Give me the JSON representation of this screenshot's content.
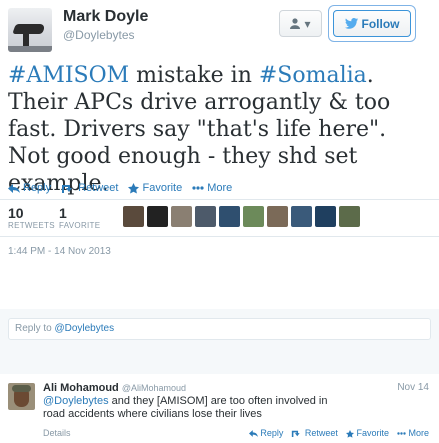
{
  "author": {
    "name": "Mark Doyle",
    "handle": "@Doylebytes"
  },
  "header": {
    "user_menu_glyph": "▾",
    "follow_label": "Follow"
  },
  "tweet": {
    "segments": [
      {
        "text": "#AMISOM",
        "hashtag": true
      },
      {
        "text": " mistake in ",
        "hashtag": false
      },
      {
        "text": "#Somalia",
        "hashtag": true
      },
      {
        "text": ". Their APCs drive arrogantly & too fast. Drivers say \"that's life here\". Not good enough - they shd set example.",
        "hashtag": false
      }
    ]
  },
  "actions": {
    "reply": "Reply",
    "retweet": "Retweet",
    "favorite": "Favorite",
    "more": "More"
  },
  "stats": {
    "retweets_count": "10",
    "retweets_label": "RETWEETS",
    "favorites_count": "1",
    "favorites_label": "FAVORITE"
  },
  "favoriters": [
    {
      "color": "#5a4a3c"
    },
    {
      "color": "#222222"
    },
    {
      "color": "#8a7f72"
    },
    {
      "color": "#4d5a6a"
    },
    {
      "color": "#2f4f6f"
    },
    {
      "color": "#6c8a5a"
    },
    {
      "color": "#7b6a58"
    },
    {
      "color": "#3a5a7a"
    },
    {
      "color": "#1f3f5f"
    },
    {
      "color": "#5c6b4a"
    }
  ],
  "timestamp": "1:44 PM - 14 Nov 2013",
  "reply_box": {
    "prefix": "Reply to ",
    "mention": "@Doylebytes"
  },
  "reply_tweet": {
    "name": "Ali Mohamoud",
    "handle": "@AliMohamoud",
    "date": "Nov 14",
    "mention": "@Doylebytes",
    "text_line1": " and they [AMISOM] are too often involved in",
    "text_line2": "road accidents where civilians lose their lives",
    "details": "Details",
    "reply": "Reply",
    "retweet": "Retweet",
    "favorite": "Favorite",
    "more": "More"
  },
  "colors": {
    "link": "#2b7bb9",
    "muted": "#8899a6",
    "text": "#292f33"
  }
}
